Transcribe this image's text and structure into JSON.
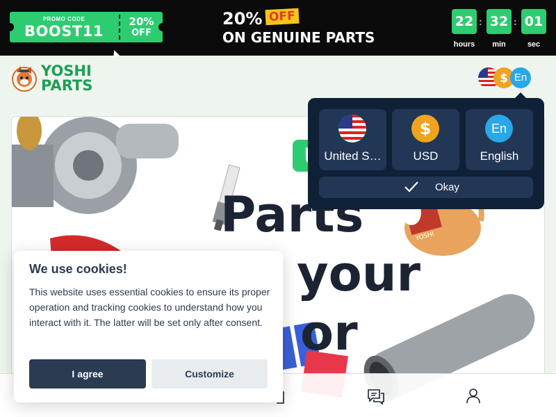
{
  "promo": {
    "code_label": "PROMO CODE",
    "code_value": "BOOST11",
    "discount_percent": "20%",
    "discount_off": "OFF"
  },
  "headline": {
    "percent": "20%",
    "off": "OFF",
    "line2": "ON GENUINE PARTS"
  },
  "countdown": {
    "hours": "22",
    "minutes": "32",
    "seconds": "01",
    "hours_label": "hours",
    "minutes_label": "min",
    "seconds_label": "sec",
    "separator": ":"
  },
  "header": {
    "logo_line1": "YOSHI",
    "logo_line2": "PARTS",
    "language_badge": "En"
  },
  "hero": {
    "badge_partial": "U",
    "title_word1": "Parts",
    "title_word2": "your",
    "title_word3": "or",
    "box_label": "YOSHI"
  },
  "locale_panel": {
    "country_label": "United S…",
    "currency_label": "USD",
    "currency_symbol": "$",
    "language_label": "English",
    "language_code": "En",
    "okay_label": "Okay"
  },
  "cookie": {
    "title": "We use cookies!",
    "body": "This website uses essential cookies to ensure its proper operation and tracking cookies to understand how you interact with it. The latter will be set only after consent.",
    "agree_label": "I agree",
    "customize_label": "Customize"
  },
  "colors": {
    "brand_green": "#2ecc71",
    "logo_green": "#1f9e55",
    "panel_navy": "#0f2137",
    "card_navy": "#223655",
    "cookie_text": "#2a3b52",
    "accent_blue": "#2aa7e8",
    "accent_orange": "#f0a31e"
  },
  "icons": {
    "flag": "us-flag-icon",
    "currency": "dollar-icon",
    "language": "language-bubble-icon",
    "okay": "checkmark-icon",
    "nav_chat": "chat-icon",
    "nav_user": "user-icon"
  }
}
